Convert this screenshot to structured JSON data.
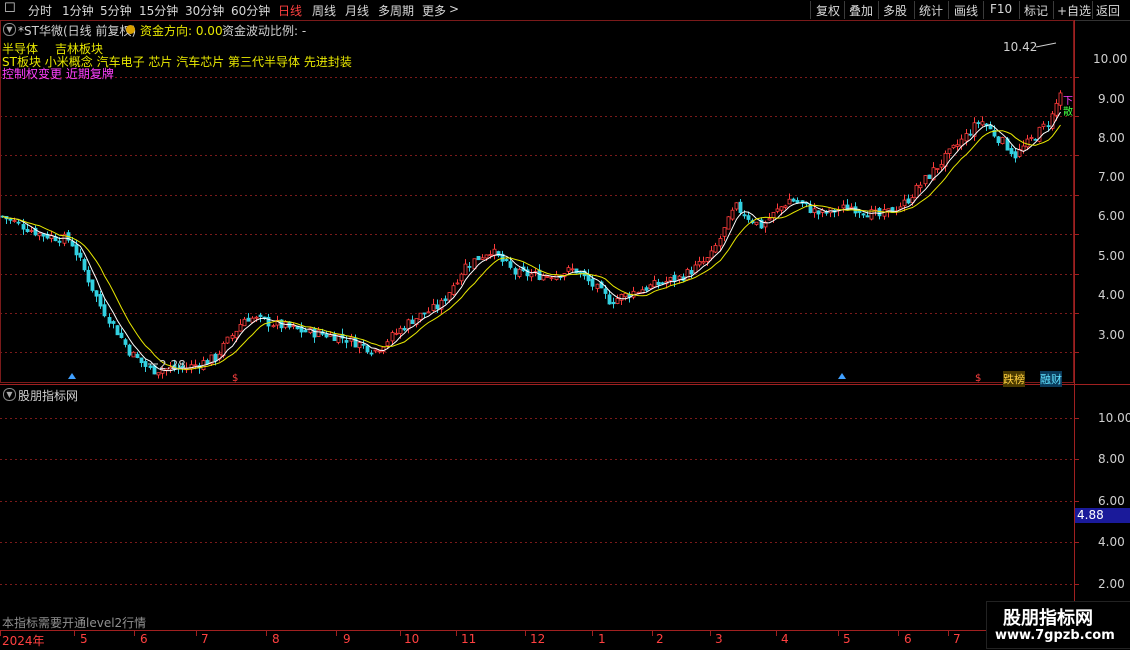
{
  "toolbar": {
    "menu_icon": "menu-icon",
    "periods": [
      "分时",
      "1分钟",
      "5分钟",
      "15分钟",
      "30分钟",
      "60分钟",
      "日线",
      "周线",
      "月线",
      "多周期",
      "更多"
    ],
    "active_period": "日线",
    "more_arrow": ">",
    "right_buttons": [
      "复权",
      "叠加",
      "多股",
      "统计",
      "画线",
      "F10",
      "标记",
      "+自选",
      "返回"
    ]
  },
  "main": {
    "collapse_icon": "chevron-down-icon",
    "title": "*ST华微(日线 前复权)",
    "fund_dir_label": "资金方向: 0.00",
    "fund_ratio_label": "资金波动比例: -",
    "tags_line1_a": "半导体",
    "tags_line1_b": "吉林板块",
    "tags_line2": "ST板块 小米概念 汽车电子 芯片 汽车芯片 第三代半导体 先进封装",
    "tags_line3": "控制权变更 近期复牌",
    "y_axis": [
      "10.00",
      "9.00",
      "8.00",
      "7.00",
      "6.00",
      "5.00",
      "4.00",
      "3.00"
    ],
    "high_label": "10.42",
    "low_label": "2.28",
    "right_marker_1": "下",
    "right_marker_2": "散",
    "event_badges": [
      "跌榜",
      "融财"
    ],
    "colors": {
      "up": "#ff3c3c",
      "down": "#33d0e0",
      "ma5": "#ffffff",
      "ma10": "#e8e800",
      "grid": "#7a1a1a",
      "axis": "#a02020"
    }
  },
  "sub": {
    "collapse_icon": "chevron-down-icon",
    "title": "股朋指标网",
    "y_axis": [
      "10.00",
      "8.00",
      "6.00",
      "4.00",
      "2.00"
    ],
    "current_value": "4.88",
    "notice": "本指标需要开通level2行情"
  },
  "x_axis": {
    "labels": [
      "2024年",
      "5",
      "6",
      "7",
      "8",
      "9",
      "10",
      "11",
      "12",
      "1",
      "2",
      "3",
      "4",
      "5",
      "6",
      "7"
    ]
  },
  "watermark": {
    "title": "股朋指标网",
    "url": "www.7gpzb.com"
  }
}
